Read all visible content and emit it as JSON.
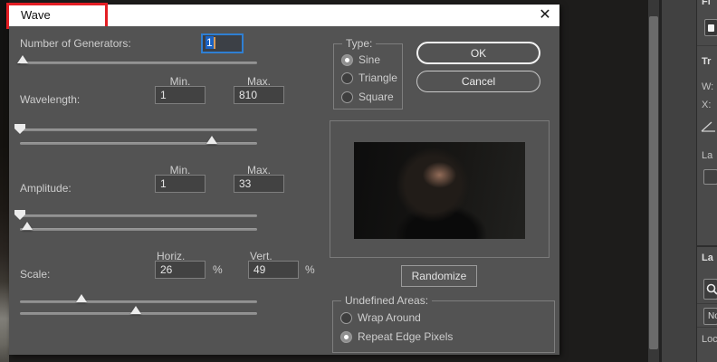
{
  "dialog": {
    "title": "Wave",
    "close_glyph": "✕",
    "generators": {
      "label": "Number of Generators:",
      "value": "1"
    },
    "headers": {
      "min": "Min.",
      "max": "Max.",
      "horiz": "Horiz.",
      "vert": "Vert."
    },
    "wavelength": {
      "label": "Wavelength:",
      "min": "1",
      "max": "810"
    },
    "amplitude": {
      "label": "Amplitude:",
      "min": "1",
      "max": "33"
    },
    "scale": {
      "label": "Scale:",
      "horiz": "26",
      "vert": "49",
      "percent": "%"
    },
    "type_group": {
      "legend": "Type:",
      "options": [
        {
          "label": "Sine",
          "selected": true
        },
        {
          "label": "Triangle",
          "selected": false
        },
        {
          "label": "Square",
          "selected": false
        }
      ]
    },
    "ok_label": "OK",
    "cancel_label": "Cancel",
    "randomize_label": "Randomize",
    "undefined_areas": {
      "legend": "Undefined Areas:",
      "options": [
        {
          "label": "Wrap Around",
          "selected": false
        },
        {
          "label": "Repeat Edge Pixels",
          "selected": true
        }
      ]
    },
    "sliders": {
      "generators_pct": 1,
      "wavelength_min_pct": 0,
      "wavelength_max_pct": 81,
      "amplitude_min_pct": 0,
      "amplitude_max_pct": 3,
      "scale_horiz_pct": 26,
      "scale_vert_pct": 49
    }
  },
  "side_panel": {
    "top_label": "Fi",
    "transform": {
      "title": "Tr",
      "w_label": "W:",
      "x_label": "X:",
      "layer_label": "La"
    },
    "layers": {
      "title": "La",
      "blend_label": "No",
      "lock_label": "Loc"
    }
  },
  "colors": {
    "dialog_bg": "#535353",
    "titlebar_bg": "#ffffff",
    "annotation_red": "#e31e24",
    "focus_blue": "#2f7fd3",
    "selection_blue": "#1b63c4",
    "caret_orange": "#d79a57"
  }
}
